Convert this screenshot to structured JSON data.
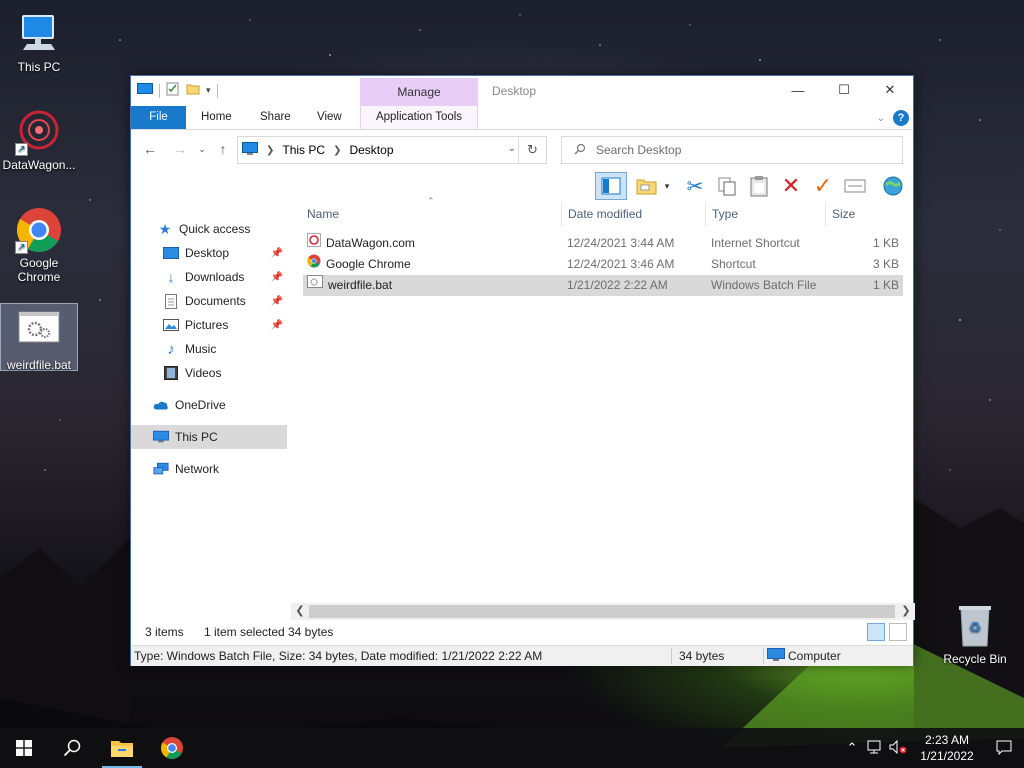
{
  "desktop": {
    "icons": [
      {
        "label": "This PC"
      },
      {
        "label": "DataWagon..."
      },
      {
        "label": "Google Chrome"
      },
      {
        "label": "weirdfile.bat"
      },
      {
        "label": "Recycle Bin"
      }
    ]
  },
  "window": {
    "title": "Desktop",
    "contextual_group": "Manage",
    "tabs": {
      "file": "File",
      "home": "Home",
      "share": "Share",
      "view": "View",
      "app_tools": "Application Tools"
    },
    "address": {
      "crumbs": [
        "This PC",
        "Desktop"
      ]
    },
    "search": {
      "placeholder": "Search Desktop"
    },
    "sidebar": {
      "quick_access": "Quick access",
      "items": [
        "Desktop",
        "Downloads",
        "Documents",
        "Pictures",
        "Music",
        "Videos"
      ],
      "onedrive": "OneDrive",
      "this_pc": "This PC",
      "network": "Network"
    },
    "columns": {
      "name": "Name",
      "date": "Date modified",
      "type": "Type",
      "size": "Size"
    },
    "files": [
      {
        "name": "DataWagon.com",
        "date": "12/24/2021 3:44 AM",
        "type": "Internet Shortcut",
        "size": "1 KB"
      },
      {
        "name": "Google Chrome",
        "date": "12/24/2021 3:46 AM",
        "type": "Shortcut",
        "size": "3 KB"
      },
      {
        "name": "weirdfile.bat",
        "date": "1/21/2022 2:22 AM",
        "type": "Windows Batch File",
        "size": "1 KB"
      }
    ],
    "status": {
      "count": "3 items",
      "selected": "1 item selected",
      "bytes": "34 bytes"
    },
    "details": {
      "info": "Type: Windows Batch File, Size: 34 bytes, Date modified: 1/21/2022 2:22 AM",
      "size": "34 bytes",
      "location": "Computer"
    }
  },
  "taskbar": {
    "time": "2:23 AM",
    "date": "1/21/2022"
  }
}
